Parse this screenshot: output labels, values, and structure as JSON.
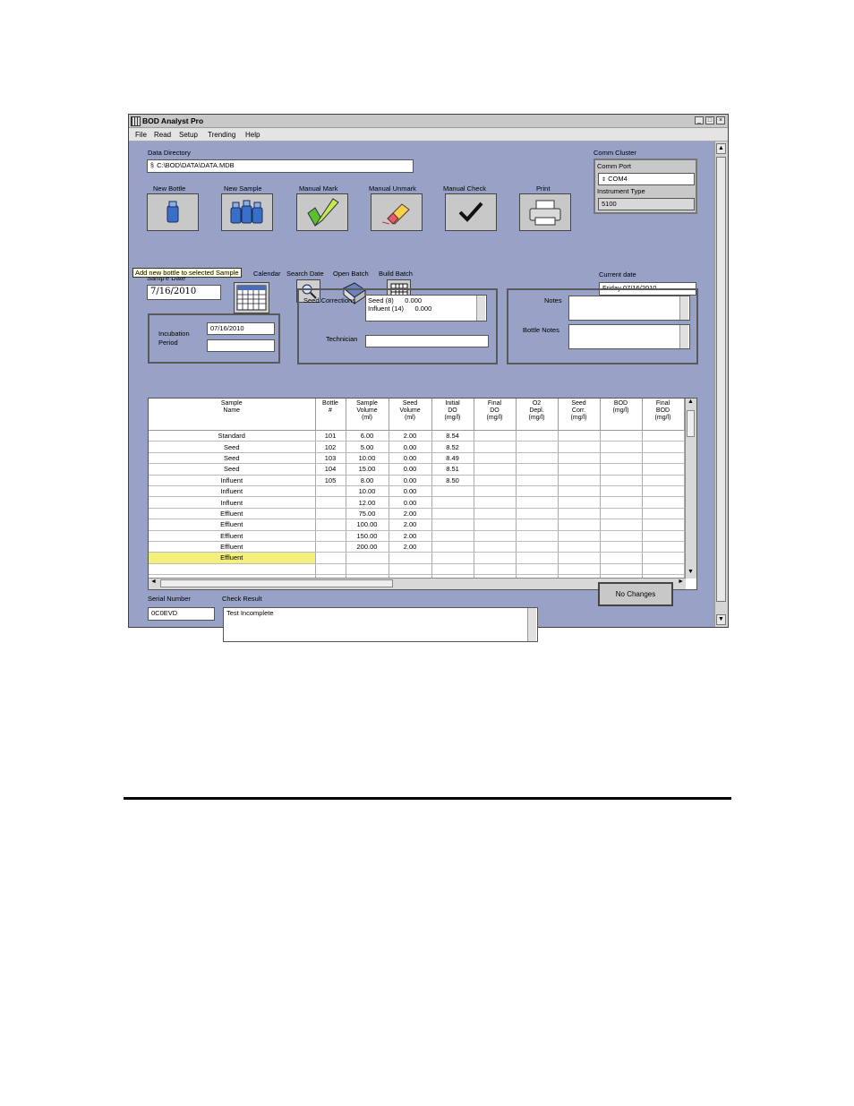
{
  "window": {
    "title": "BOD Analyst Pro",
    "btn_min": "_",
    "btn_max": "□",
    "btn_close": "×"
  },
  "menu": [
    "File",
    "Read",
    "Setup",
    "Trending",
    "Help"
  ],
  "data_directory": {
    "label": "Data Directory",
    "value": "C:\\BOD\\DATA\\DATA.MDB"
  },
  "comm": {
    "cluster_label": "Comm Cluster",
    "port_label": "Comm Port",
    "port_value": "COM4",
    "instrument_label": "Instrument Type",
    "instrument_value": "5100"
  },
  "toolbar": [
    {
      "label": "New Bottle",
      "icon": "bottle-icon"
    },
    {
      "label": "New Sample",
      "icon": "bottles-icon"
    },
    {
      "label": "Manual Mark",
      "icon": "highlighter-icon"
    },
    {
      "label": "Manual Unmark",
      "icon": "eraser-icon"
    },
    {
      "label": "Manual Check",
      "icon": "checkmark-icon"
    },
    {
      "label": "Print",
      "icon": "printer-icon"
    }
  ],
  "tooltip": "Add new bottle to selected Sample",
  "sample_date": {
    "label_partial": "Samp'e Date",
    "value": "7/16/2010"
  },
  "small_buttons": {
    "calendar": "Calendar",
    "search": "Search Date",
    "open_batch": "Open Batch",
    "build_batch": "Build Batch"
  },
  "current_date": {
    "label": "Current date",
    "value": "Friday 07/16/2010"
  },
  "incubation": {
    "label_line1": "Incubation",
    "label_line2": "Period",
    "value": "07/16/2010",
    "value2": ""
  },
  "seed": {
    "label": "Seed Corrections",
    "line1": "Seed (8)      0.000",
    "line2": "Influent (14)      0.000",
    "technician_label": "Technician",
    "technician_value": ""
  },
  "notes": {
    "label": "Notes",
    "bottle_notes_label": "Bottle Notes"
  },
  "table": {
    "headers": [
      [
        "Sample",
        "Name",
        ""
      ],
      [
        "Bottle",
        "#",
        ""
      ],
      [
        "Sample",
        "Volume",
        "(ml)"
      ],
      [
        "Seed",
        "Volume",
        "(ml)"
      ],
      [
        "Initial",
        "DO",
        "(mg/l)"
      ],
      [
        "Final",
        "DO",
        "(mg/l)"
      ],
      [
        "O2",
        "Depl.",
        "(mg/l)"
      ],
      [
        "Seed",
        "Corr.",
        "(mg/l)"
      ],
      [
        "BOD",
        "(mg/l)",
        ""
      ],
      [
        "Final",
        "BOD",
        "(mg/l)"
      ]
    ],
    "rows": [
      [
        "Standard",
        "101",
        "6.00",
        "2.00",
        "8.54",
        "",
        "",
        "",
        "",
        ""
      ],
      [
        "Seed",
        "102",
        "5.00",
        "0.00",
        "8.52",
        "",
        "",
        "",
        "",
        ""
      ],
      [
        "Seed",
        "103",
        "10.00",
        "0.00",
        "8.49",
        "",
        "",
        "",
        "",
        ""
      ],
      [
        "Seed",
        "104",
        "15.00",
        "0.00",
        "8.51",
        "",
        "",
        "",
        "",
        ""
      ],
      [
        "Influent",
        "105",
        "8.00",
        "0.00",
        "8.50",
        "",
        "",
        "",
        "",
        ""
      ],
      [
        "Influent",
        "",
        "10.00",
        "0.00",
        "",
        "",
        "",
        "",
        "",
        ""
      ],
      [
        "Influent",
        "",
        "12.00",
        "0.00",
        "",
        "",
        "",
        "",
        "",
        ""
      ],
      [
        "Effluent",
        "",
        "75.00",
        "2.00",
        "",
        "",
        "",
        "",
        "",
        ""
      ],
      [
        "Effluent",
        "",
        "100.00",
        "2.00",
        "",
        "",
        "",
        "",
        "",
        ""
      ],
      [
        "Effluent",
        "",
        "150.00",
        "2.00",
        "",
        "",
        "",
        "",
        "",
        ""
      ],
      [
        "Effluent",
        "",
        "200.00",
        "2.00",
        "",
        "",
        "",
        "",
        "",
        ""
      ],
      [
        "Effluent",
        "",
        "",
        "",
        "",
        "",
        "",
        "",
        "",
        ""
      ],
      [
        "",
        "",
        "",
        "",
        "",
        "",
        "",
        "",
        "",
        ""
      ],
      [
        "",
        "",
        "",
        "",
        "",
        "",
        "",
        "",
        "",
        ""
      ]
    ],
    "selected_row": 11
  },
  "serial": {
    "label": "Serial Number",
    "value": "0C0EVD"
  },
  "check": {
    "label": "Check Result",
    "value": "Test Incomplete"
  },
  "no_changes": "No Changes"
}
